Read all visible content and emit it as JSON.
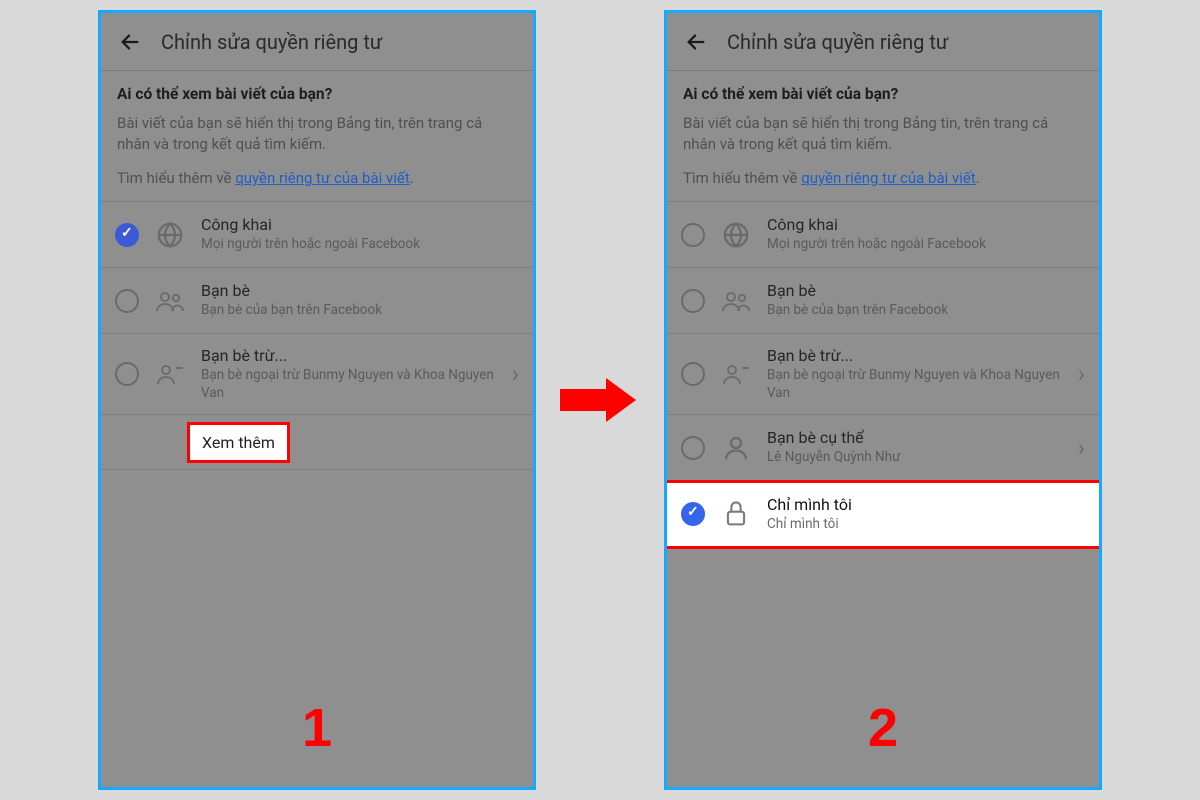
{
  "header": {
    "title": "Chỉnh sửa quyền riêng tư"
  },
  "intro": {
    "question": "Ai có thể xem bài viết của bạn?",
    "description": "Bài viết của bạn sẽ hiển thị trong Bảng tin, trên trang cá nhân và trong kết quả tìm kiếm.",
    "learn_prefix": "Tìm hiểu thêm về ",
    "learn_link": "quyền riêng tư của bài viết",
    "learn_suffix": "."
  },
  "options": {
    "public": {
      "label": "Công khai",
      "sub": "Mọi người trên hoặc ngoài Facebook"
    },
    "friends": {
      "label": "Bạn bè",
      "sub": "Bạn bè của bạn trên Facebook"
    },
    "friends_except": {
      "label": "Bạn bè trừ...",
      "sub": "Bạn bè ngoại trừ Bunmy Nguyen và Khoa Nguyen Van"
    },
    "specific_friends": {
      "label": "Bạn bè cụ thể",
      "sub": "Lê Nguyễn Quỳnh Như"
    },
    "only_me": {
      "label": "Chỉ mình tôi",
      "sub": "Chỉ mình tôi"
    }
  },
  "see_more": "Xem thêm",
  "steps": {
    "one": "1",
    "two": "2"
  }
}
